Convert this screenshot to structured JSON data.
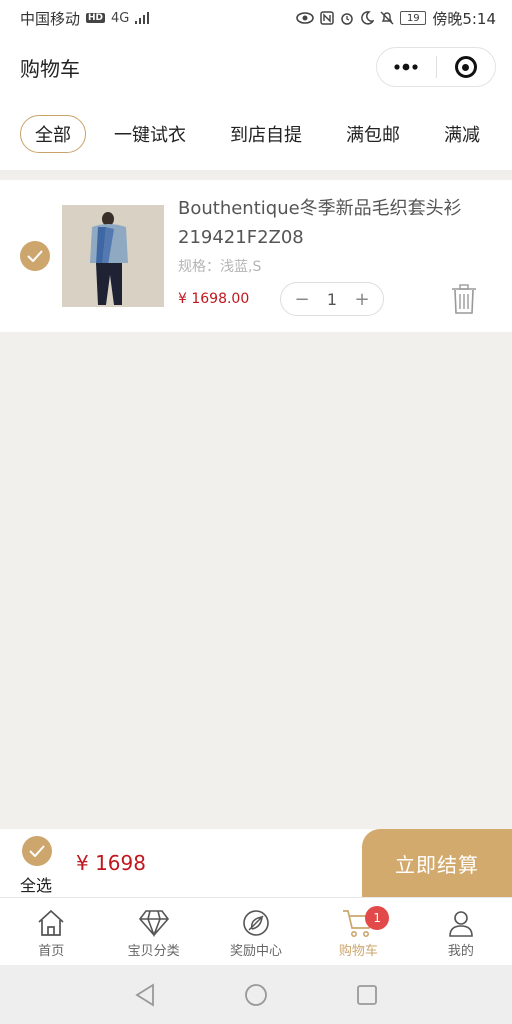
{
  "status_bar": {
    "carrier": "中国移动",
    "network": "4G",
    "battery": "19",
    "time": "傍晚5:14"
  },
  "header": {
    "title": "购物车",
    "menu_icon": "more-icon",
    "close_icon": "target-icon"
  },
  "tabs": [
    {
      "label": "全部",
      "active": true
    },
    {
      "label": "一键试衣"
    },
    {
      "label": "到店自提"
    },
    {
      "label": "满包邮"
    },
    {
      "label": "满减"
    }
  ],
  "cart_item": {
    "title": "Bouthentique冬季新品毛织套头衫219421F2Z08",
    "spec": "规格：浅蓝,S",
    "price": "¥ 1698.00",
    "quantity": "1",
    "minus": "−",
    "plus": "+"
  },
  "checkout": {
    "select_all": "全选",
    "total": "¥ 1698",
    "button": "立即结算"
  },
  "nav": [
    {
      "label": "首页",
      "icon": "home-icon"
    },
    {
      "label": "宝贝分类",
      "icon": "diamond-icon"
    },
    {
      "label": "奖励中心",
      "icon": "leaf-icon"
    },
    {
      "label": "购物车",
      "icon": "cart-icon",
      "active": true,
      "badge": "1"
    },
    {
      "label": "我的",
      "icon": "user-icon"
    }
  ],
  "colors": {
    "accent": "#cca66d",
    "price": "#c0171e",
    "badge": "#e24a4a"
  }
}
